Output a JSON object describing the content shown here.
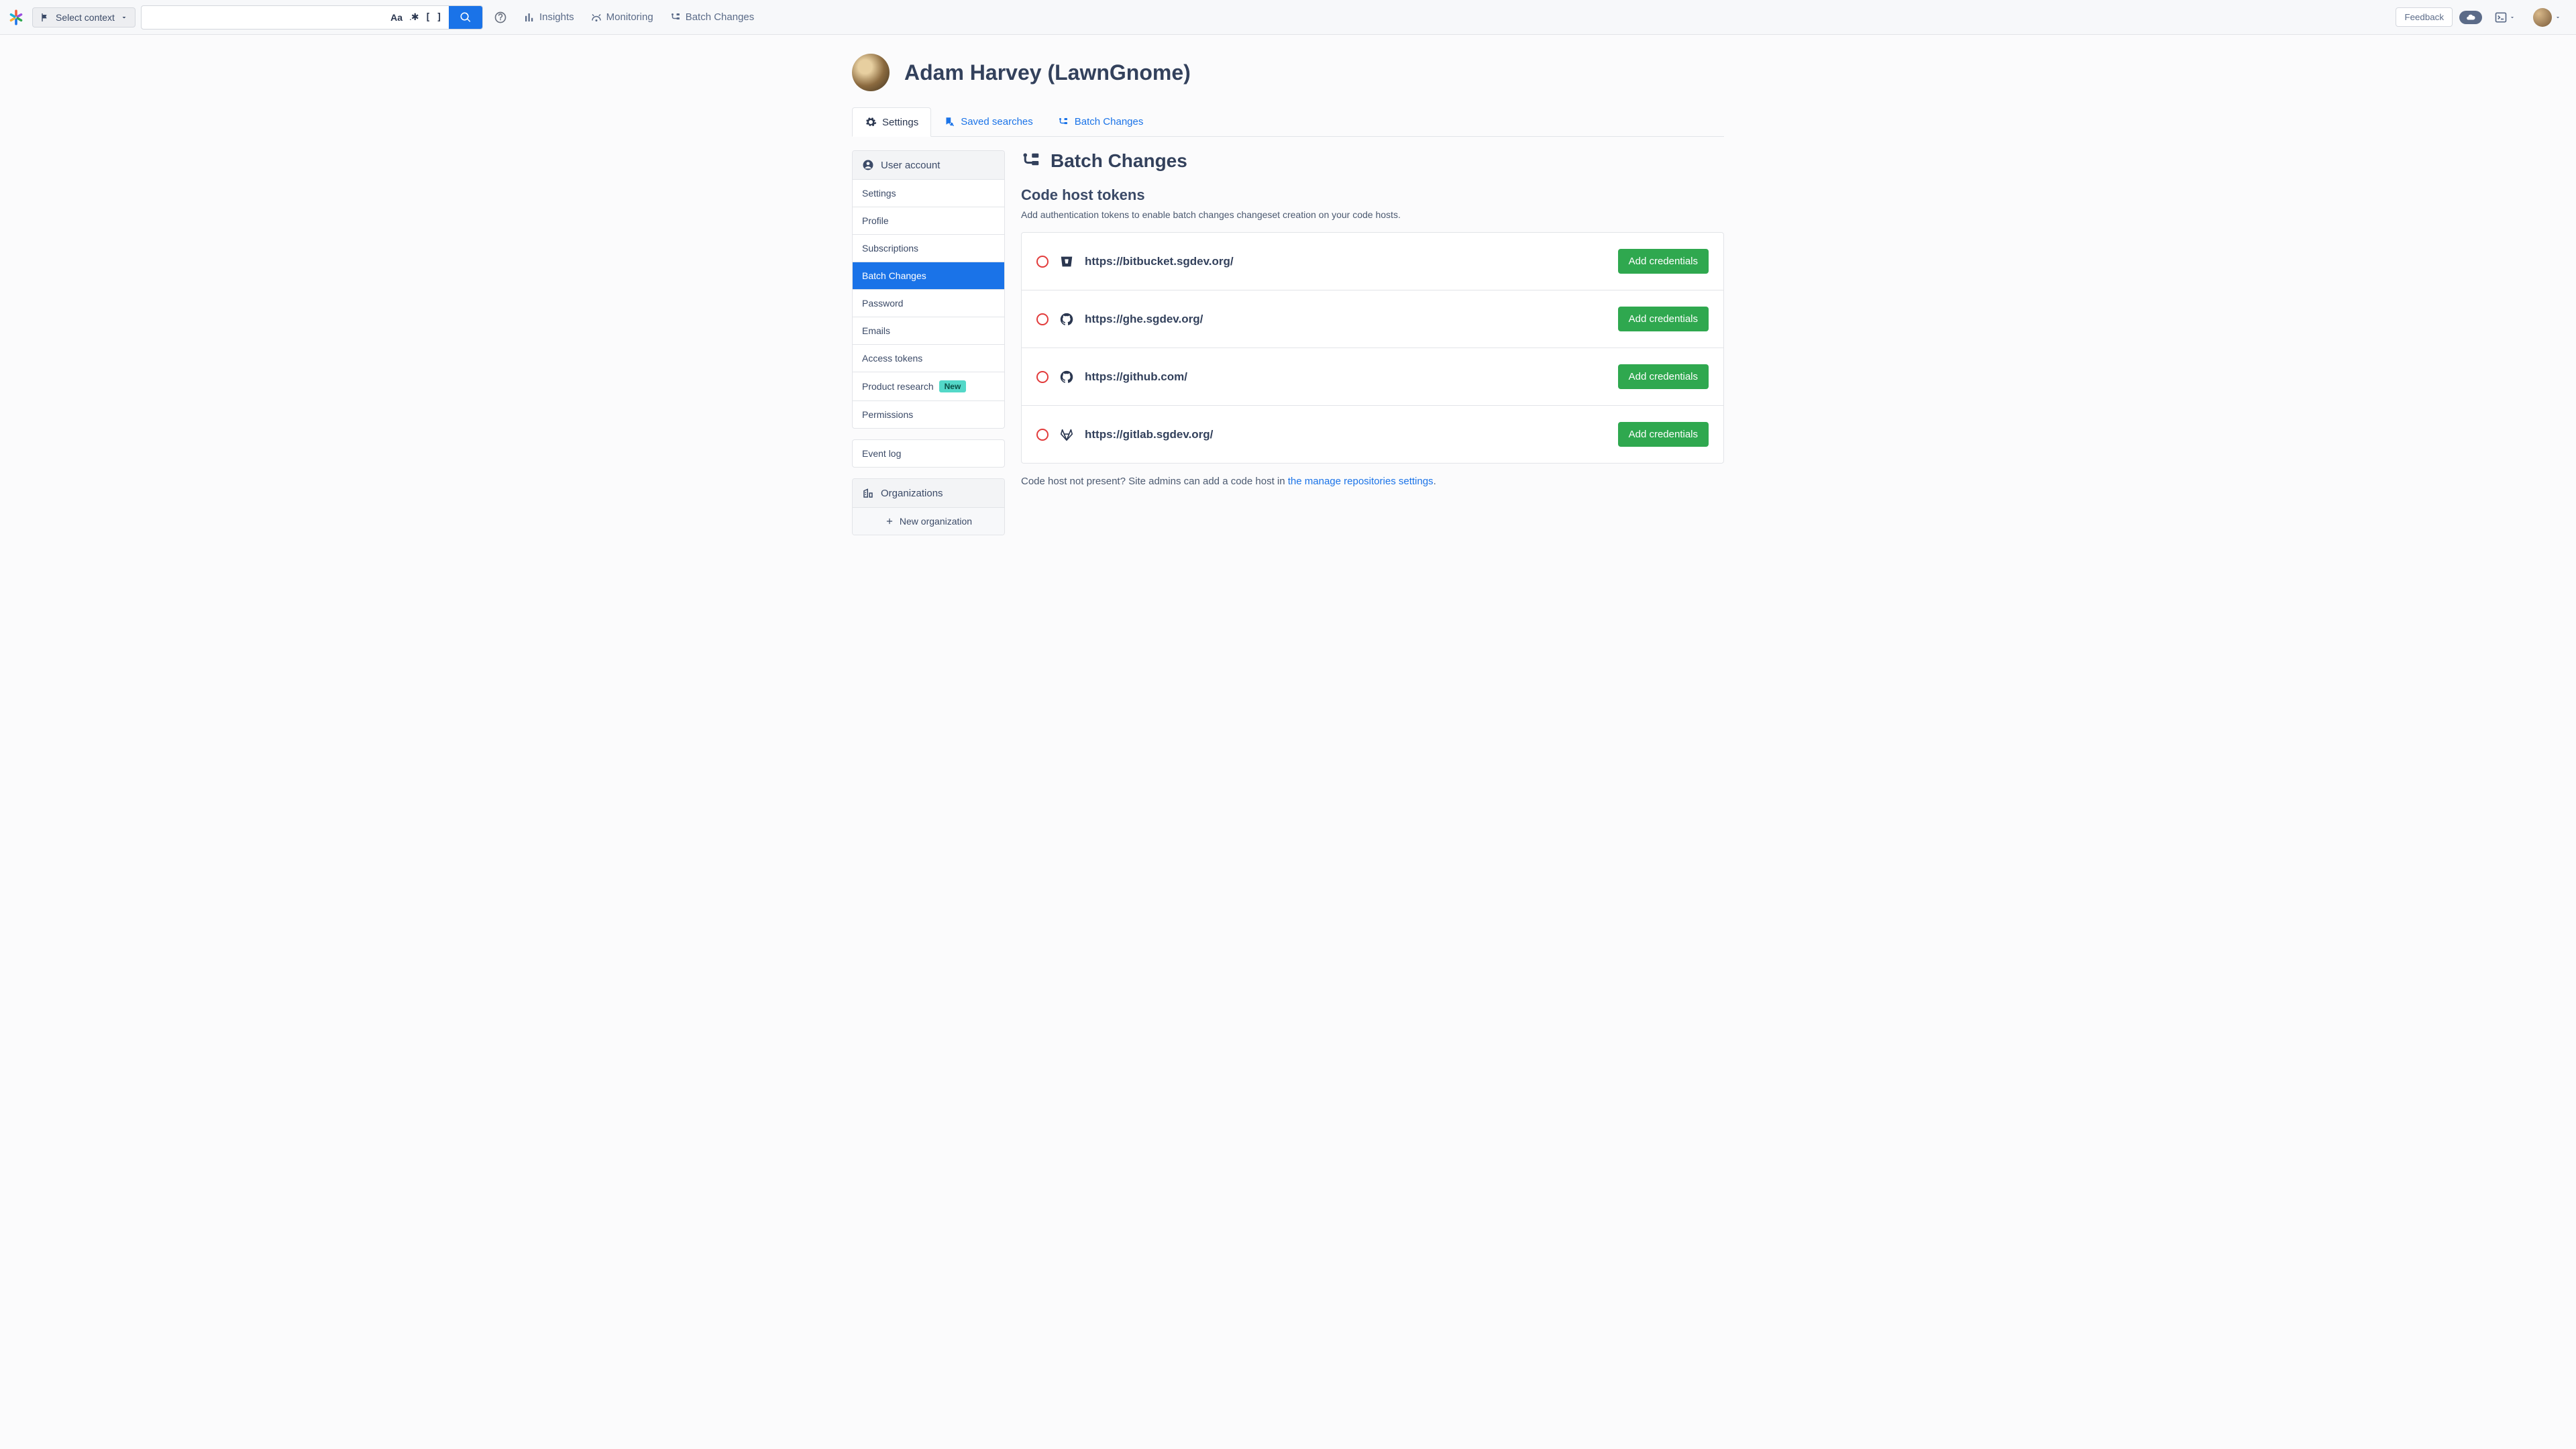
{
  "nav": {
    "context_label": "Select context",
    "insights": "Insights",
    "monitoring": "Monitoring",
    "batch_changes": "Batch Changes",
    "feedback": "Feedback"
  },
  "header": {
    "title": "Adam Harvey (LawnGnome)"
  },
  "tabs": {
    "settings": "Settings",
    "saved_searches": "Saved searches",
    "batch_changes": "Batch Changes"
  },
  "sidebar": {
    "user_account": "User account",
    "items": [
      "Settings",
      "Profile",
      "Subscriptions",
      "Batch Changes",
      "Password",
      "Emails",
      "Access tokens",
      "Product research",
      "Permissions"
    ],
    "new_badge": "New",
    "event_log": "Event log",
    "organizations": "Organizations",
    "new_org": "New organization"
  },
  "content": {
    "title": "Batch Changes",
    "section_title": "Code host tokens",
    "section_desc": "Add authentication tokens to enable batch changes changeset creation on your code hosts.",
    "add_button": "Add credentials",
    "hosts": [
      {
        "icon": "bitbucket",
        "url": "https://bitbucket.sgdev.org/"
      },
      {
        "icon": "github",
        "url": "https://ghe.sgdev.org/"
      },
      {
        "icon": "github",
        "url": "https://github.com/"
      },
      {
        "icon": "gitlab",
        "url": "https://gitlab.sgdev.org/"
      }
    ],
    "footnote_pre": "Code host not present? Site admins can add a code host in ",
    "footnote_link": "the manage repositories settings",
    "footnote_post": "."
  }
}
